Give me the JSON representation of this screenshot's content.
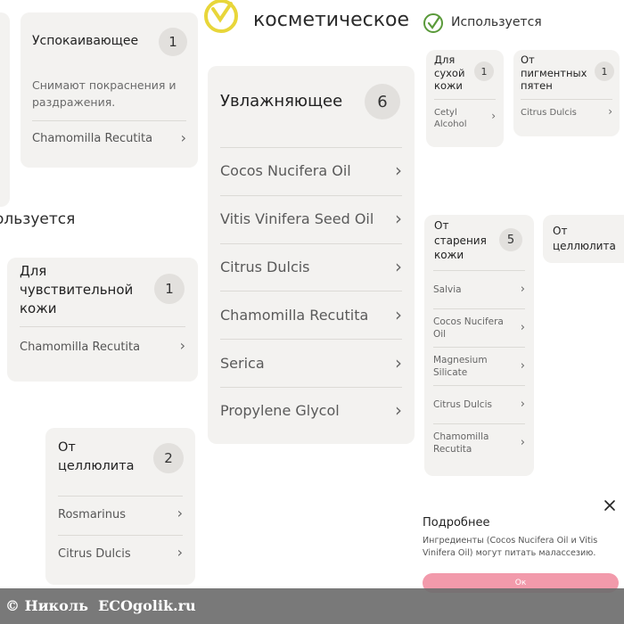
{
  "header": {
    "heading_fragment": "косметическое",
    "used_label": "Используется",
    "used_fragment": "ользуется"
  },
  "cards": {
    "calming": {
      "title": "Успокаивающее",
      "count": "1",
      "description": "Снимают покраснения и раздражения.",
      "items": [
        "Chamomilla Recutita"
      ]
    },
    "moisturizing": {
      "title": "Увлажняющее",
      "count": "6",
      "items": [
        "Cocos Nucifera Oil",
        "Vitis Vinifera Seed Oil",
        "Citrus Dulcis",
        "Chamomilla Recutita",
        "Serica",
        "Propylene Glycol"
      ]
    },
    "dry_skin": {
      "title_lines": [
        "Для",
        "сухой",
        "кожи"
      ],
      "count": "1",
      "items": [
        "Cetyl Alcohol"
      ]
    },
    "pigment": {
      "title_lines": [
        "От",
        "пигментных",
        "пятен"
      ],
      "count": "1",
      "items": [
        "Citrus Dulcis"
      ]
    },
    "sensitive": {
      "title_lines": [
        "Для",
        "чувствительной",
        "кожи"
      ],
      "count": "1",
      "items": [
        "Chamomilla Recutita"
      ]
    },
    "aging": {
      "title_lines": [
        "От",
        "старения",
        "кожи"
      ],
      "count": "5",
      "items": [
        "Salvia",
        "Cocos Nucifera Oil",
        "Magnesium Silicate",
        "Citrus Dulcis",
        "Chamomilla Recutita"
      ]
    },
    "cellulite_small": {
      "title_lines": [
        "От",
        "целлюлита"
      ]
    },
    "cellulite": {
      "title_lines": [
        "От",
        "целлюлита"
      ],
      "count": "2",
      "items": [
        "Rosmarinus",
        "Citrus Dulcis"
      ]
    }
  },
  "popup": {
    "title": "Подробнее",
    "text": "Ингредиенты (Cocos Nucifera Oil и Vitis Vinifera Oil) могут питать малассезию.",
    "ok_label": "Ок",
    "close_icon": "close-icon"
  },
  "watermark": {
    "text": "© Николь  ECOgolik.ru"
  },
  "colors": {
    "accent_yellow": "#e8d63a",
    "check_green": "#5a9a3a",
    "ok_pink": "#f29aab",
    "card_bg": "#f3f2f0",
    "watermark_bar": "#7a7a7a"
  },
  "chevron_glyph": "›"
}
